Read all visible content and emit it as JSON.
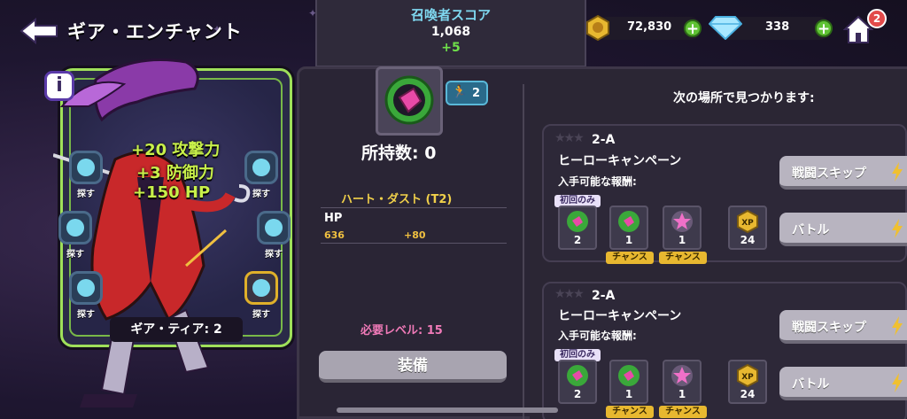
{
  "header": {
    "title": "ギア・エンチャント",
    "score_label": "召喚者スコア",
    "score_value": "1,068",
    "score_delta": "+5"
  },
  "currency": {
    "coins": "72,830",
    "gems": "338",
    "notifications": "2"
  },
  "card": {
    "stats": [
      "+20 攻撃力",
      "+3 防御力",
      "+150 HP"
    ],
    "slot_label": "探す",
    "tier_label": "ギア・ティア: 2"
  },
  "gear": {
    "power": "2",
    "owned": "所持数: 0",
    "name": "ハート・ダスト (T2)",
    "stat_name": "HP",
    "stat_value": "636",
    "stat_add": "+80",
    "required_level": "必要レベル: 15",
    "equip_label": "装備"
  },
  "sources": {
    "heading": "次の場所で見つかります:",
    "entries": [
      {
        "stage": "2-A",
        "campaign": "ヒーローキャンペーン",
        "rewards_label": "入手可能な報酬:",
        "first_label": "初回のみ",
        "rewards": [
          {
            "count": "2",
            "tag": ""
          },
          {
            "count": "1",
            "tag": "チャンス"
          },
          {
            "count": "1",
            "tag": "チャンス"
          },
          {
            "count": "24",
            "tag": ""
          }
        ],
        "skip_label": "戦闘スキップ",
        "battle_label": "バトル"
      },
      {
        "stage": "2-A",
        "campaign": "ヒーローキャンペーン",
        "rewards_label": "入手可能な報酬:",
        "first_label": "初回のみ",
        "rewards": [
          {
            "count": "2",
            "tag": ""
          },
          {
            "count": "1",
            "tag": "チャンス"
          },
          {
            "count": "1",
            "tag": "チャンス"
          },
          {
            "count": "24",
            "tag": ""
          }
        ],
        "skip_label": "戦闘スキップ",
        "battle_label": "バトル"
      }
    ]
  },
  "xp_label": "XP",
  "colors": {
    "accent_green": "#9fe05a",
    "gold": "#e8b830",
    "pink": "#f07ab8",
    "cyan": "#7fd8f0"
  }
}
